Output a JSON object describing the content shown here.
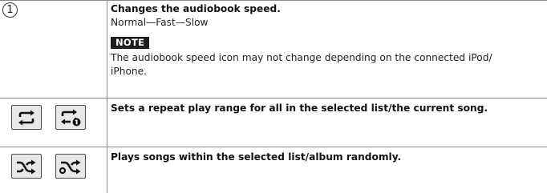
{
  "rows": [
    {
      "marker": "1",
      "heading": "Changes the audiobook speed.",
      "options": "Normal—Fast—Slow",
      "note_label": "NOTE",
      "note_line1": "The audiobook speed icon may not change depending on the connected iPod/",
      "note_line2": "iPhone."
    },
    {
      "icons": [
        "repeat-all-icon",
        "repeat-one-icon"
      ],
      "heading": "Sets a repeat play range for all in the selected list/the current song."
    },
    {
      "icons": [
        "shuffle-off-icon",
        "shuffle-album-icon"
      ],
      "heading": "Plays songs within the selected list/album randomly."
    }
  ]
}
